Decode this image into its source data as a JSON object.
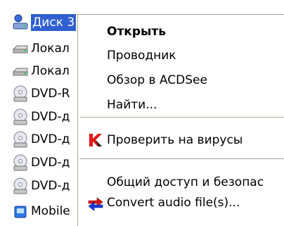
{
  "tree": {
    "items": [
      {
        "label": "Диск 3",
        "icon": "disk-icon",
        "selected": true
      },
      {
        "label": "Локал",
        "icon": "local-drive-icon"
      },
      {
        "label": "Локал",
        "icon": "local-drive-icon"
      },
      {
        "label": "DVD-R",
        "icon": "dvd-drive-icon"
      },
      {
        "label": "DVD-д",
        "icon": "dvd-drive-icon"
      },
      {
        "label": "DVD-д",
        "icon": "dvd-drive-icon"
      },
      {
        "label": "DVD-д",
        "icon": "dvd-drive-icon"
      },
      {
        "label": "DVD-д",
        "icon": "dvd-drive-icon"
      },
      {
        "label": "Mobile",
        "icon": "mobile-device-icon"
      }
    ]
  },
  "context_menu": {
    "open": "Открыть",
    "explorer": "Проводник",
    "acdsee": "Обзор в ACDSee",
    "find": "Найти...",
    "virus_scan": "Проверить на вирусы",
    "sharing": "Общий доступ и безопас",
    "convert_audio": "Convert audio file(s)..."
  },
  "colors": {
    "selection": "#2f5fd0",
    "separator": "#aca899"
  }
}
